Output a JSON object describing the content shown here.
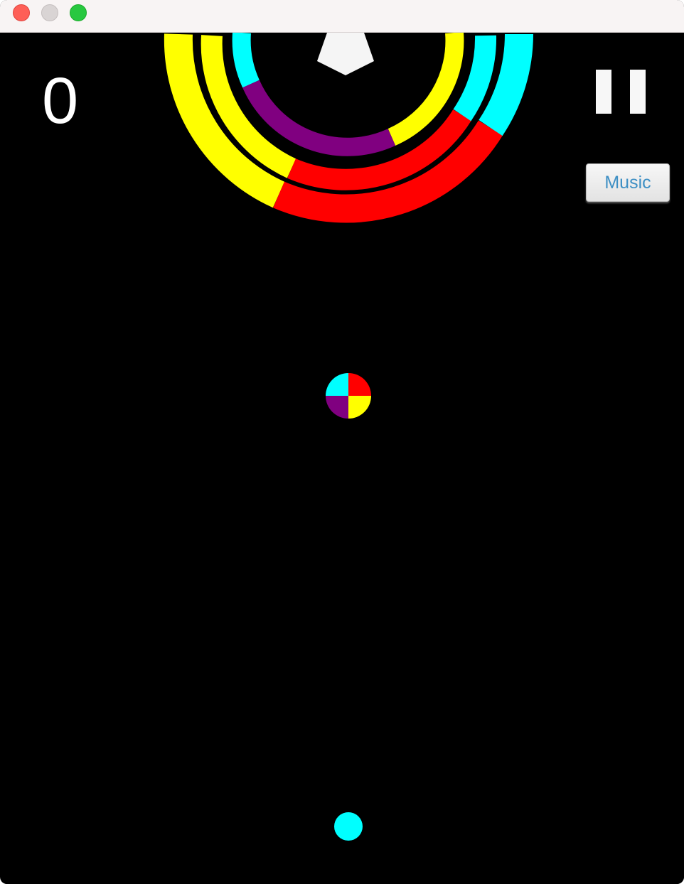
{
  "score": "0",
  "controls": {
    "music_label": "Music"
  },
  "icons": {
    "pause": "pause-icon",
    "star": "star-icon",
    "color_switcher": "color-switch-orb",
    "player": "player-ball"
  },
  "colors": {
    "cyan": "#00ffff",
    "yellow": "#ffff00",
    "red": "#ff0000",
    "purple": "#800080",
    "background": "#000000",
    "player": "#00ffff"
  }
}
